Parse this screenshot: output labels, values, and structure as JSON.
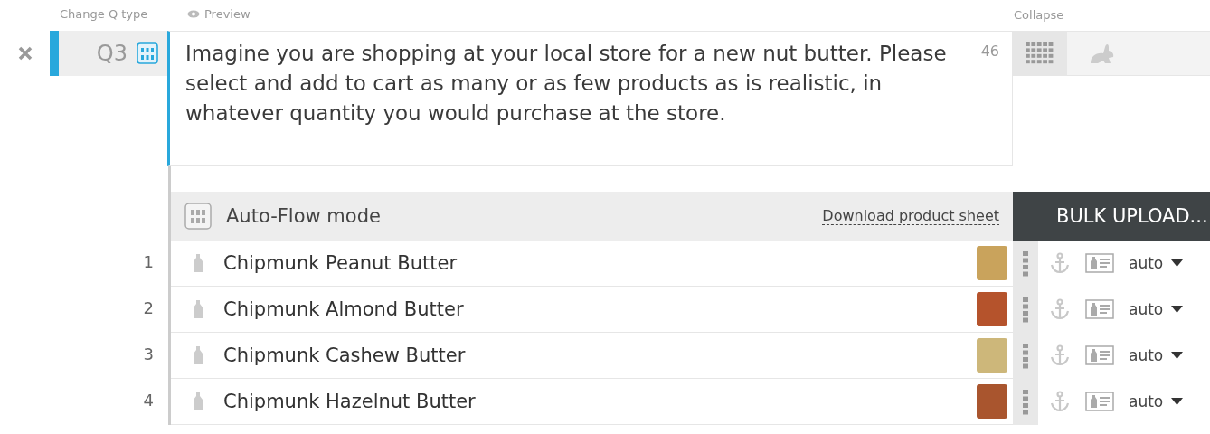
{
  "header": {
    "change_type": "Change Q type",
    "preview": "Preview",
    "collapse": "Collapse"
  },
  "question": {
    "label": "Q3",
    "text": "Imagine you are shopping at your local store for a new nut butter. Please select and add to cart as many or as few products as is realistic, in whatever quantity you would purchase at the store.",
    "count": "46",
    "selected": true
  },
  "mode_bar": {
    "title": "Auto-Flow mode",
    "link": "Download product sheet",
    "bulk_button": "BULK UPLOAD..."
  },
  "products": [
    {
      "number": "1",
      "name": "Chipmunk Peanut Butter",
      "color": "#c9a35c",
      "mode": "auto"
    },
    {
      "number": "2",
      "name": "Chipmunk Almond Butter",
      "color": "#b5532c",
      "mode": "auto"
    },
    {
      "number": "3",
      "name": "Chipmunk Cashew Butter",
      "color": "#cdb77a",
      "mode": "auto"
    },
    {
      "number": "4",
      "name": "Chipmunk Hazelnut Butter",
      "color": "#a9552e",
      "mode": "auto"
    }
  ]
}
